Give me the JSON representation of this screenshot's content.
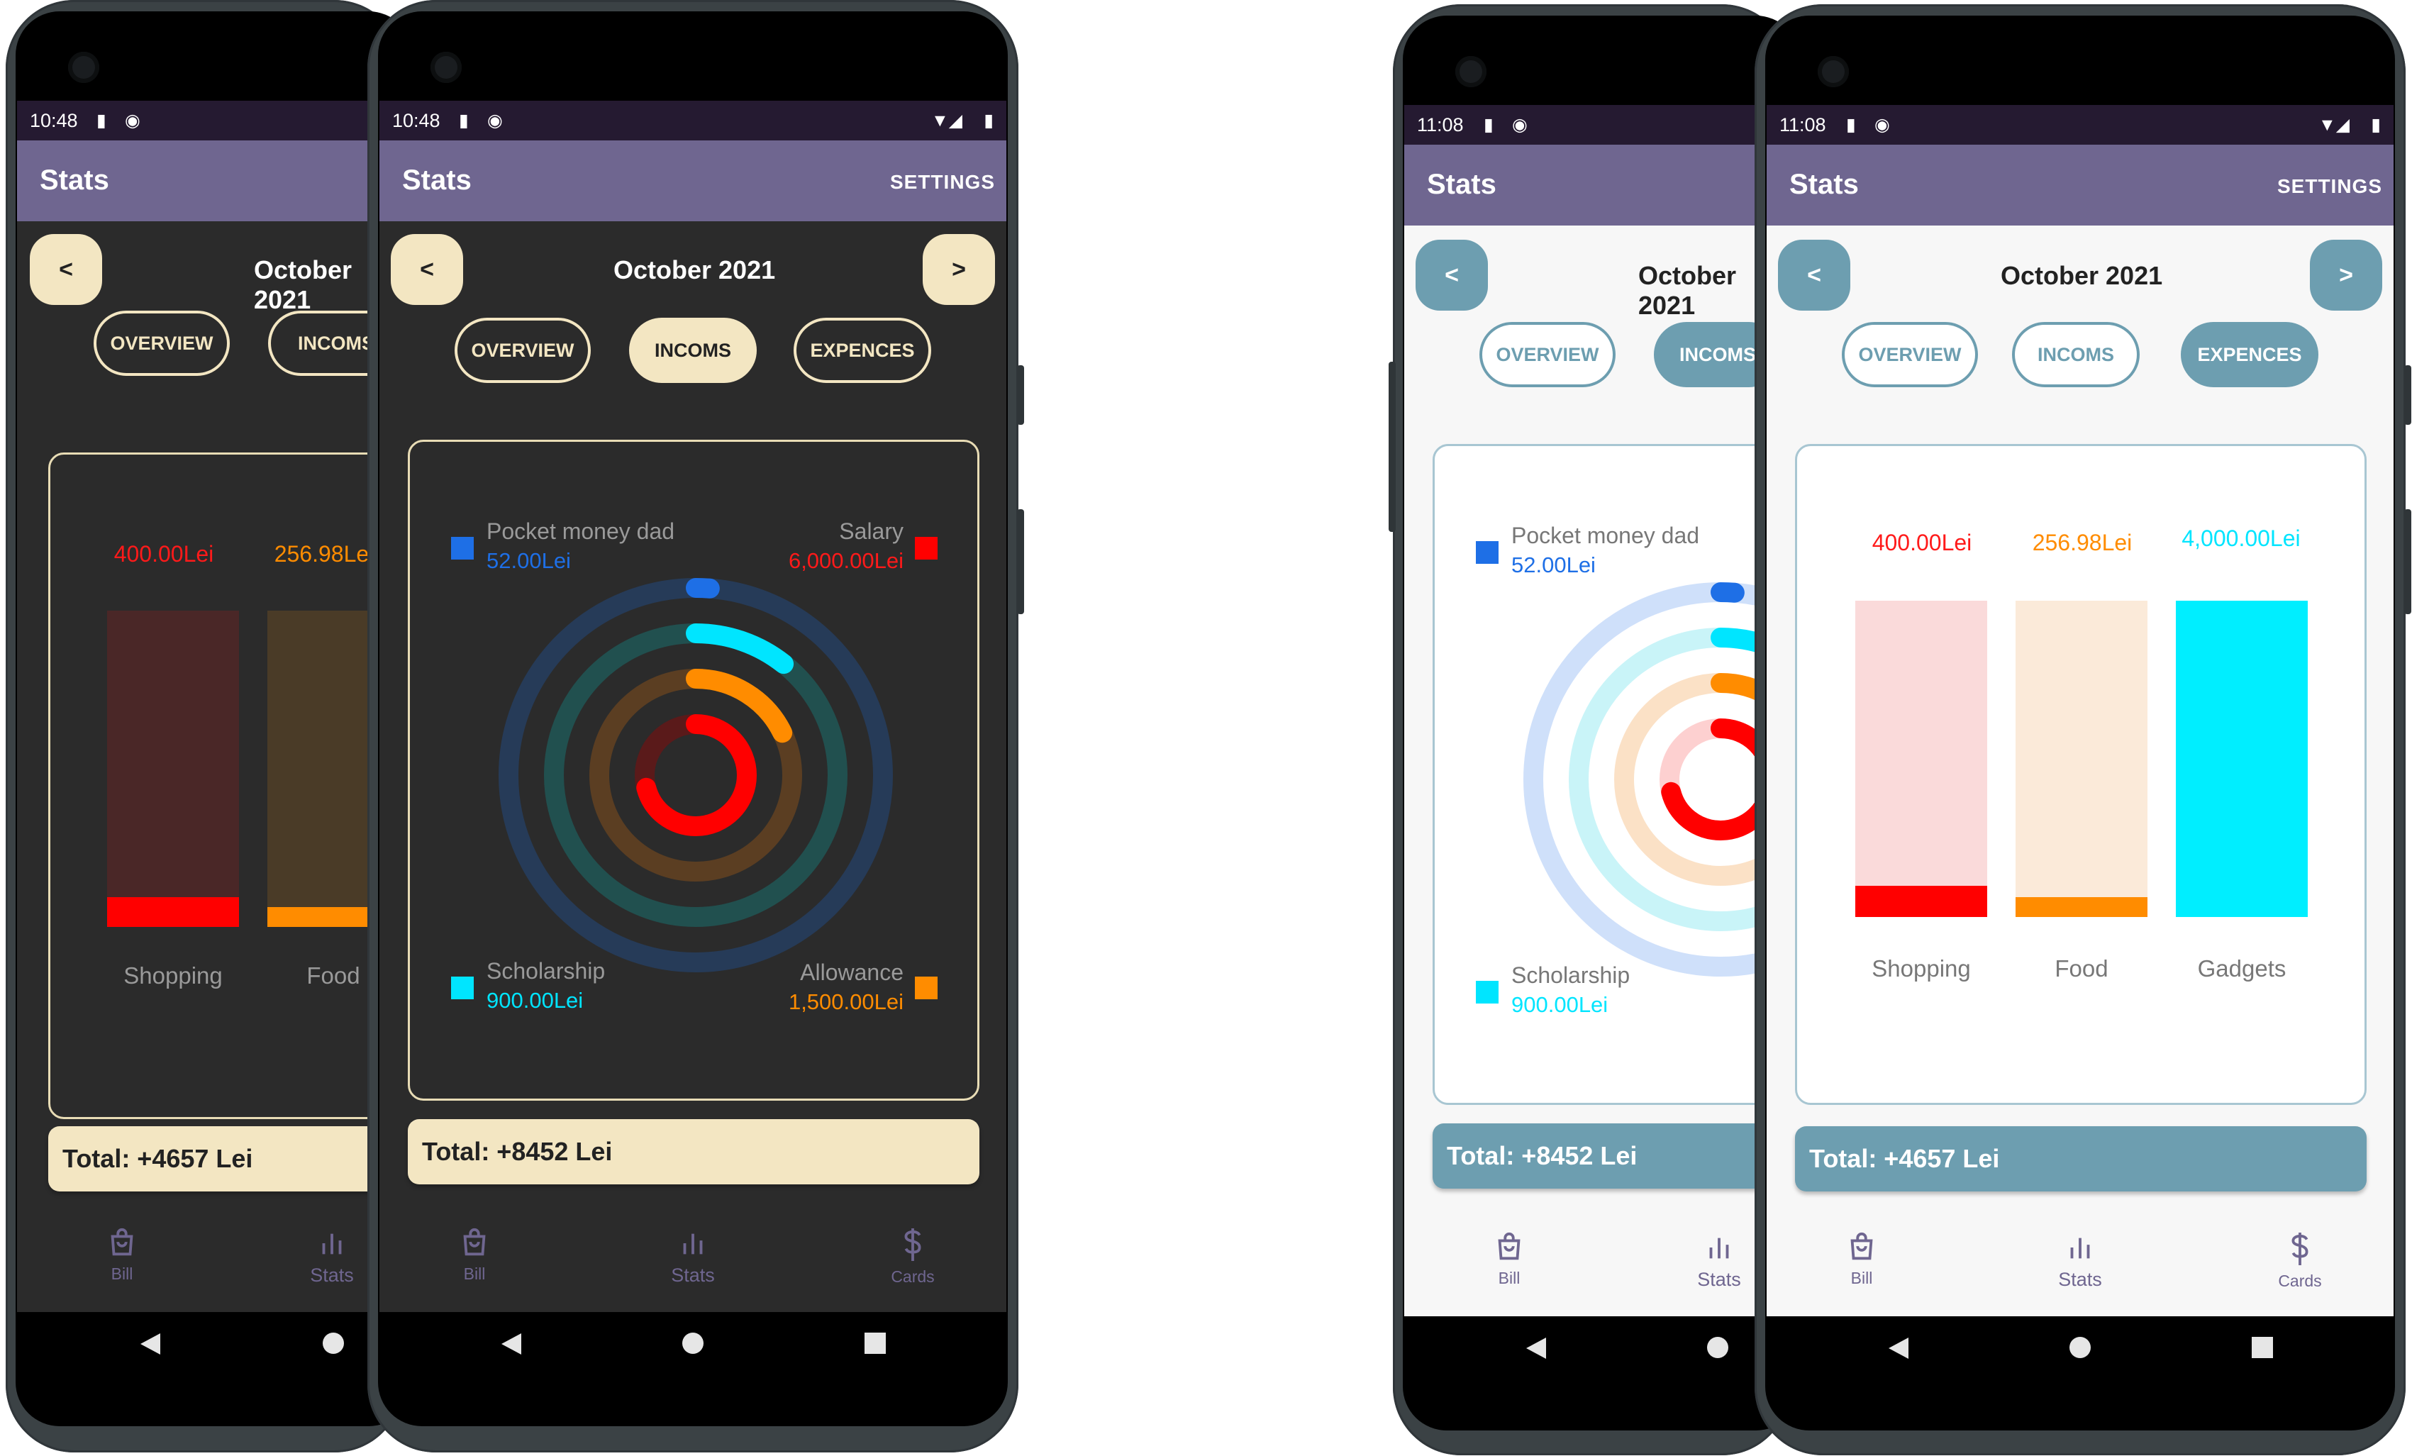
{
  "status_time": {
    "dark": "10:48",
    "light": "11:08"
  },
  "app_title": "Stats",
  "settings_label": "SETTINGS",
  "month": "October 2021",
  "prev_label": "<",
  "next_label": ">",
  "tabs": {
    "overview": "OVERVIEW",
    "incomes": "INCOMS",
    "expenses": "EXPENCES"
  },
  "incomes": {
    "items": [
      {
        "name": "Pocket money dad",
        "value": "52.00Lei",
        "color": "#1e6fe6"
      },
      {
        "name": "Salary",
        "value": "6,000.00Lei",
        "color": "#ff0000"
      },
      {
        "name": "Scholarship",
        "value": "900.00Lei",
        "color": "#00e5ff"
      },
      {
        "name": "Allowance",
        "value": "1,500.00Lei",
        "color": "#ff8c00"
      }
    ],
    "total": "Total:  +8452 Lei"
  },
  "expenses": {
    "items": [
      {
        "name": "Shopping",
        "value": "400.00Lei",
        "color": "#ff0000"
      },
      {
        "name": "Food",
        "value": "256.98Lei",
        "color": "#ff8c00"
      },
      {
        "name": "Gadgets",
        "value": "4,000.00Lei",
        "color": "#00e5ff"
      }
    ],
    "total": "Total:  +4657 Lei"
  },
  "chart_data": [
    {
      "type": "bar",
      "categories": [
        "Shopping",
        "Food",
        "Gadgets"
      ],
      "values": [
        400.0,
        256.98,
        4000.0
      ],
      "title": "",
      "xlabel": "",
      "ylabel": ""
    },
    {
      "type": "pie",
      "categories": [
        "Pocket money dad",
        "Salary",
        "Scholarship",
        "Allowance"
      ],
      "values": [
        52.0,
        6000.0,
        900.0,
        1500.0
      ],
      "title": ""
    }
  ],
  "bottom_nav": {
    "bill": "Bill",
    "stats": "Stats",
    "cards": "Cards"
  },
  "theme": {
    "dark_bg": "#2b2b2b",
    "dark_accent": "#f3e6c2",
    "light_bg": "#f7f7f7",
    "light_accent": "#6d9eb0",
    "appbar": "#6f6690",
    "statusbar": "#251a31"
  },
  "icons": {
    "bill": "shopping-bag-icon",
    "stats": "bar-chart-icon",
    "cards": "dollar-icon",
    "back": "triangle-back-icon",
    "home": "circle-home-icon",
    "recents": "square-recents-icon"
  }
}
